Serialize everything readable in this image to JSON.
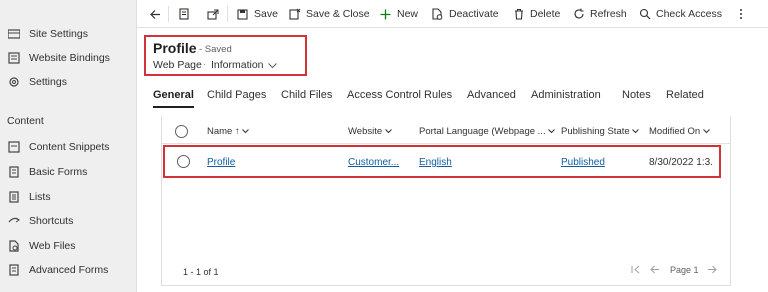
{
  "sidebar": {
    "items_top": [
      {
        "label": "Site Settings",
        "icon": "site-settings-icon"
      },
      {
        "label": "Website Bindings",
        "icon": "website-bindings-icon"
      },
      {
        "label": "Settings",
        "icon": "gear-icon"
      }
    ],
    "section_header": "Content",
    "items_content": [
      {
        "label": "Content Snippets",
        "icon": "content-snippets-icon"
      },
      {
        "label": "Basic Forms",
        "icon": "basic-forms-icon"
      },
      {
        "label": "Lists",
        "icon": "lists-icon"
      },
      {
        "label": "Shortcuts",
        "icon": "shortcuts-icon"
      },
      {
        "label": "Web Files",
        "icon": "web-files-icon"
      },
      {
        "label": "Advanced Forms",
        "icon": "advanced-forms-icon"
      }
    ]
  },
  "toolbar": {
    "save": "Save",
    "save_close": "Save & Close",
    "new": "New",
    "deactivate": "Deactivate",
    "delete": "Delete",
    "refresh": "Refresh",
    "check_access": "Check Access"
  },
  "header": {
    "title": "Profile",
    "status": "- Saved",
    "entity": "Web Page",
    "separator": "·",
    "form": "Information"
  },
  "tabs": [
    "General",
    "Child Pages",
    "Child Files",
    "Access Control Rules",
    "Advanced",
    "Administration",
    "Notes",
    "Related"
  ],
  "grid": {
    "columns": [
      "Name ↑",
      "Website",
      "Portal Language (Webpage ...",
      "Publishing State",
      "Modified On"
    ],
    "rows": [
      {
        "name": "Profile",
        "website": "Customer...",
        "language": "English",
        "state": "Published",
        "modified": "8/30/2022 1:3."
      }
    ],
    "count": "1 - 1 of 1",
    "page": "Page 1"
  },
  "colors": {
    "highlight": "#d13438",
    "link": "#115ea3",
    "accent_new": "#107c10"
  }
}
